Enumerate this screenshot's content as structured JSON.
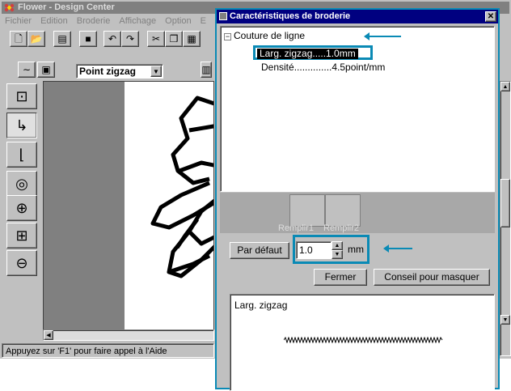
{
  "app": {
    "title": "Flower - Design Center",
    "menu": [
      "Fichier",
      "Edition",
      "Broderie",
      "Affichage",
      "Option",
      "E"
    ],
    "stitch_type": "Point zigzag",
    "status": "Appuyez sur 'F1' pour faire appel à l'Aide"
  },
  "dialog": {
    "title": "Caractéristiques de broderie",
    "tree_root": "Couture de ligne",
    "tree_selected": "Larg. zigzag.....1.0mm",
    "tree_item2": "Densité..............4.5point/mm",
    "pattern1": "Remplir1",
    "pattern2": "Remplir2",
    "default_button": "Par défaut",
    "spin_value": "1.0",
    "unit": "mm",
    "close_button": "Fermer",
    "hint_button": "Conseil pour masquer",
    "preview_label": "Larg. zigzag"
  },
  "colors": {
    "highlight": "#0a8ab5",
    "title_active": "#000080",
    "title_inactive": "#808080"
  }
}
